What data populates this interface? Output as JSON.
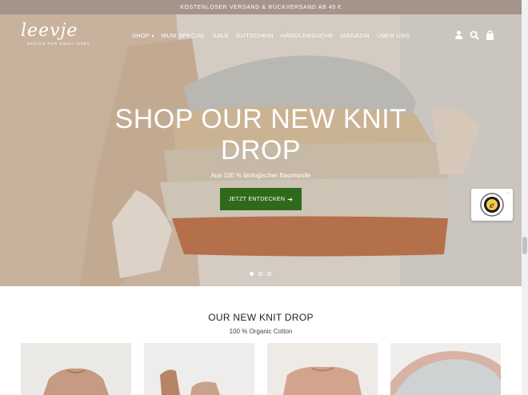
{
  "announcement": "KOSTENLOSER VERSAND & RÜCKVERSAND AB 49 €",
  "logo": {
    "wordmark": "leevje",
    "tagline": "DESIGN FOR SMALL ONES"
  },
  "nav": {
    "shop": "SHOP",
    "mum_special": "MUM SPECIAL",
    "sale": "SALE",
    "gutschein": "GUTSCHEIN",
    "haendlersuche": "HÄNDLERSUCHE",
    "magazin": "MAGAZIN",
    "ueber_uns": "ÜBER UNS"
  },
  "header_icons": [
    "user-icon",
    "search-icon",
    "bag-icon"
  ],
  "hero": {
    "headline_line1": "SHOP OUR NEW KNIT",
    "headline_line2": "DROP",
    "subline": "Aus 100 % biologischer Baumwolle",
    "cta": "JETZT ENTDECKEN",
    "slides": 3,
    "active_slide": 1
  },
  "section": {
    "title": "OUR NEW KNIT DROP",
    "subtitle": "100 % Organic Cotton"
  },
  "colors": {
    "announcement_bg": "#a4948a",
    "cta_bg": "#2f6a1a"
  }
}
